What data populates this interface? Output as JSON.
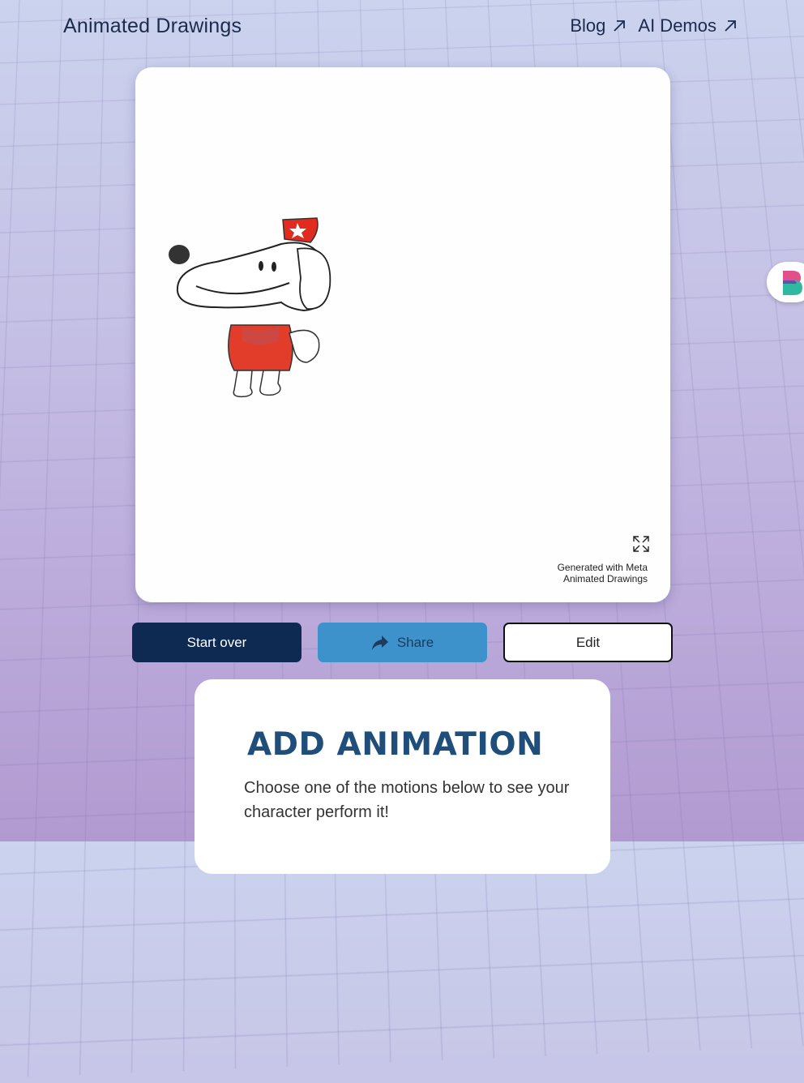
{
  "header": {
    "brand": "Animated Drawings",
    "nav": [
      {
        "label": "Blog",
        "icon": "arrow-up-right-icon"
      },
      {
        "label": "AI Demos",
        "icon": "arrow-up-right-icon"
      }
    ]
  },
  "stage": {
    "watermark_line1": "Generated with Meta",
    "watermark_line2": "Animated Drawings",
    "expand_icon": "expand-icon",
    "character": "red-capped cartoon dog drawing"
  },
  "actions": {
    "start_over": "Start over",
    "share": "Share",
    "edit": "Edit"
  },
  "panel": {
    "title": "ADD ANIMATION",
    "description": "Choose one of the motions below to see your character perform it!"
  },
  "colors": {
    "navy": "#0e2a52",
    "share_blue": "#3e92cc",
    "title_blue": "#1f4e7b"
  }
}
